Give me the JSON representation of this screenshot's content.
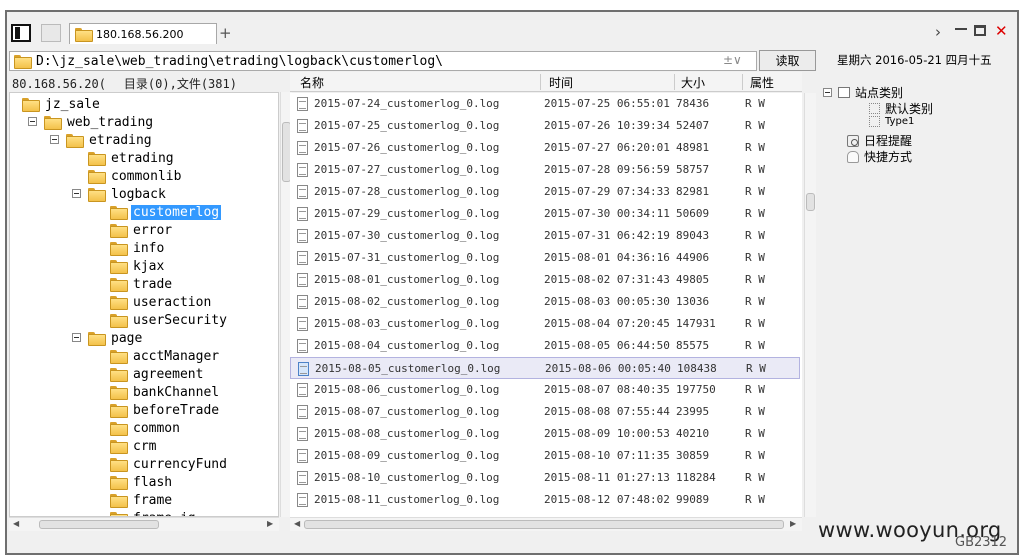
{
  "tab": {
    "title": "180.168.56.200"
  },
  "path": "D:\\jz_sale\\web_trading\\etrading\\logback\\customerlog\\",
  "address_arrows": "±∨",
  "read_button": "读取",
  "date_text": "星期六 2016-05-21 四月十五",
  "tree_header": {
    "host": "80.168.56.20(",
    "dir_count": "目录(0),文件(381)"
  },
  "columns": {
    "name": "名称",
    "time": "时间",
    "size": "大小",
    "attr": "属性"
  },
  "tree": [
    {
      "label": "jz_sale",
      "depth": 0,
      "toggle": false
    },
    {
      "label": "web_trading",
      "depth": 1,
      "toggle": true
    },
    {
      "label": "etrading",
      "depth": 2,
      "toggle": true
    },
    {
      "label": "etrading",
      "depth": 3,
      "toggle": false
    },
    {
      "label": "commonlib",
      "depth": 3,
      "toggle": false
    },
    {
      "label": "logback",
      "depth": 3,
      "toggle": true
    },
    {
      "label": "customerlog",
      "depth": 4,
      "toggle": false,
      "selected": true
    },
    {
      "label": "error",
      "depth": 4,
      "toggle": false
    },
    {
      "label": "info",
      "depth": 4,
      "toggle": false
    },
    {
      "label": "kjax",
      "depth": 4,
      "toggle": false
    },
    {
      "label": "trade",
      "depth": 4,
      "toggle": false
    },
    {
      "label": "useraction",
      "depth": 4,
      "toggle": false
    },
    {
      "label": "userSecurity",
      "depth": 4,
      "toggle": false
    },
    {
      "label": "page",
      "depth": 3,
      "toggle": true
    },
    {
      "label": "acctManager",
      "depth": 4,
      "toggle": false
    },
    {
      "label": "agreement",
      "depth": 4,
      "toggle": false
    },
    {
      "label": "bankChannel",
      "depth": 4,
      "toggle": false
    },
    {
      "label": "beforeTrade",
      "depth": 4,
      "toggle": false
    },
    {
      "label": "common",
      "depth": 4,
      "toggle": false
    },
    {
      "label": "crm",
      "depth": 4,
      "toggle": false
    },
    {
      "label": "currencyFund",
      "depth": 4,
      "toggle": false
    },
    {
      "label": "flash",
      "depth": 4,
      "toggle": false
    },
    {
      "label": "frame",
      "depth": 4,
      "toggle": false
    },
    {
      "label": "frame_jg",
      "depth": 4,
      "toggle": false
    }
  ],
  "files": [
    {
      "name": "2015-07-24_customerlog_0.log",
      "time": "2015-07-25 06:55:01",
      "size": "78436",
      "attr": "R W"
    },
    {
      "name": "2015-07-25_customerlog_0.log",
      "time": "2015-07-26 10:39:34",
      "size": "52407",
      "attr": "R W"
    },
    {
      "name": "2015-07-26_customerlog_0.log",
      "time": "2015-07-27 06:20:01",
      "size": "48981",
      "attr": "R W"
    },
    {
      "name": "2015-07-27_customerlog_0.log",
      "time": "2015-07-28 09:56:59",
      "size": "58757",
      "attr": "R W"
    },
    {
      "name": "2015-07-28_customerlog_0.log",
      "time": "2015-07-29 07:34:33",
      "size": "82981",
      "attr": "R W"
    },
    {
      "name": "2015-07-29_customerlog_0.log",
      "time": "2015-07-30 00:34:11",
      "size": "50609",
      "attr": "R W"
    },
    {
      "name": "2015-07-30_customerlog_0.log",
      "time": "2015-07-31 06:42:19",
      "size": "89043",
      "attr": "R W"
    },
    {
      "name": "2015-07-31_customerlog_0.log",
      "time": "2015-08-01 04:36:16",
      "size": "44906",
      "attr": "R W"
    },
    {
      "name": "2015-08-01_customerlog_0.log",
      "time": "2015-08-02 07:31:43",
      "size": "49805",
      "attr": "R W"
    },
    {
      "name": "2015-08-02_customerlog_0.log",
      "time": "2015-08-03 00:05:30",
      "size": "13036",
      "attr": "R W"
    },
    {
      "name": "2015-08-03_customerlog_0.log",
      "time": "2015-08-04 07:20:45",
      "size": "147931",
      "attr": "R W"
    },
    {
      "name": "2015-08-04_customerlog_0.log",
      "time": "2015-08-05 06:44:50",
      "size": "85575",
      "attr": "R W"
    },
    {
      "name": "2015-08-05_customerlog_0.log",
      "time": "2015-08-06 00:05:40",
      "size": "108438",
      "attr": "R W",
      "selected": true
    },
    {
      "name": "2015-08-06_customerlog_0.log",
      "time": "2015-08-07 08:40:35",
      "size": "197750",
      "attr": "R W"
    },
    {
      "name": "2015-08-07_customerlog_0.log",
      "time": "2015-08-08 07:55:44",
      "size": "23995",
      "attr": "R W"
    },
    {
      "name": "2015-08-08_customerlog_0.log",
      "time": "2015-08-09 10:00:53",
      "size": "40210",
      "attr": "R W"
    },
    {
      "name": "2015-08-09_customerlog_0.log",
      "time": "2015-08-10 07:11:35",
      "size": "30859",
      "attr": "R W"
    },
    {
      "name": "2015-08-10_customerlog_0.log",
      "time": "2015-08-11 01:27:13",
      "size": "118284",
      "attr": "R W"
    },
    {
      "name": "2015-08-11_customerlog_0.log",
      "time": "2015-08-12 07:48:02",
      "size": "99089",
      "attr": "R W"
    }
  ],
  "right_panel": {
    "site_category": "站点类别",
    "default_category": "默认类别",
    "type1": "Type1",
    "schedule": "日程提醒",
    "shortcut": "快捷方式"
  },
  "watermark": "www.wooyun.org",
  "encoding": "GB2312"
}
